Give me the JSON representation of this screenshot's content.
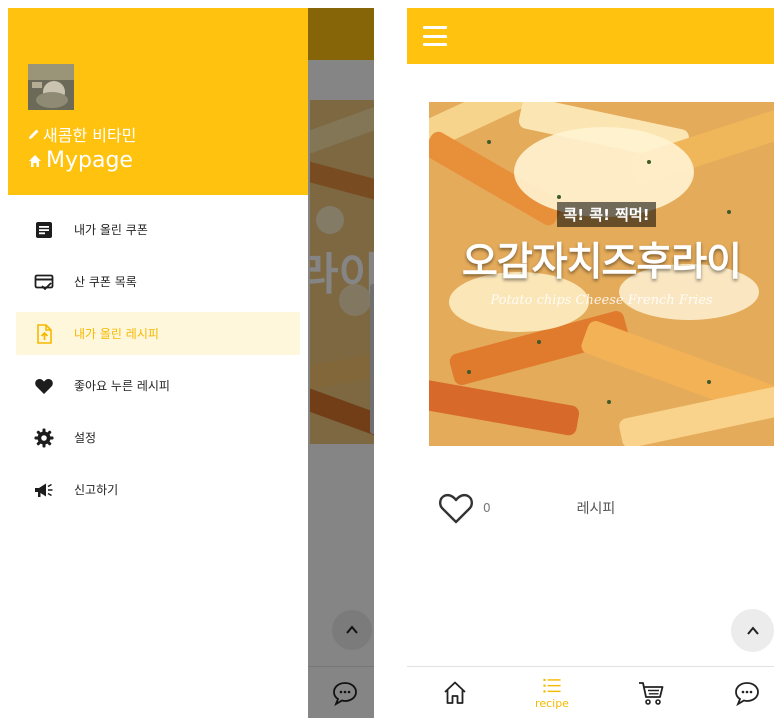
{
  "drawer": {
    "nickname": "새콤한 비타민",
    "mypage_label": "Mypage",
    "menu": [
      {
        "label": "내가 올린 쿠폰",
        "icon": "document-icon",
        "active": false
      },
      {
        "label": "산 쿠폰 목록",
        "icon": "coupon-card-icon",
        "active": false
      },
      {
        "label": "내가 올린 레시피",
        "icon": "file-upload-icon",
        "active": true
      },
      {
        "label": "좋아요 누른 레시피",
        "icon": "heart-icon",
        "active": false
      },
      {
        "label": "설정",
        "icon": "gear-icon",
        "active": false
      },
      {
        "label": "신고하기",
        "icon": "megaphone-icon",
        "active": false
      }
    ]
  },
  "background": {
    "image_text": "라이"
  },
  "recipe_screen": {
    "image": {
      "badge": "콕! 콕! 찍먹!",
      "title": "오감자치즈후라이",
      "subtitle": "Potato chips Cheese French Fries"
    },
    "like_count": "0",
    "category_label": "레시피"
  },
  "bottom_nav": {
    "items": [
      {
        "name": "home",
        "icon": "home-icon",
        "label": ""
      },
      {
        "name": "recipe",
        "icon": "list-icon",
        "label": "recipe"
      },
      {
        "name": "cart",
        "icon": "cart-icon",
        "label": ""
      },
      {
        "name": "chat",
        "icon": "chat-icon",
        "label": ""
      }
    ]
  },
  "colors": {
    "brand_yellow": "#ffc20e",
    "active_text": "#f6b900",
    "active_bg": "#fff7dc"
  }
}
